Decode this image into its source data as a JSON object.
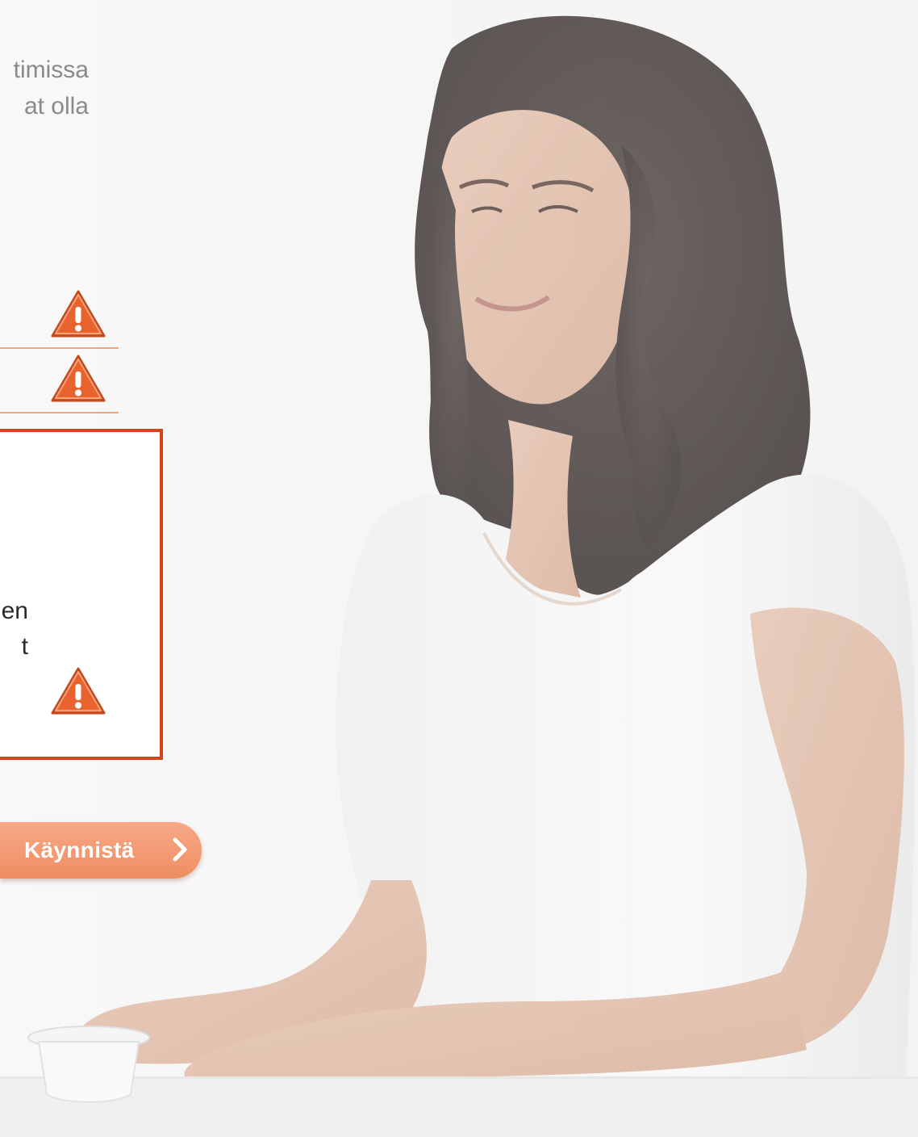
{
  "intro": {
    "line1": "timissa",
    "line2": "at olla"
  },
  "alert": {
    "line1": "en",
    "line2": "t"
  },
  "icons": {
    "warning": "warning-triangle-icon",
    "chevron": "chevron-right-icon"
  },
  "start_button": {
    "label": "Käynnistä"
  },
  "colors": {
    "accent": "#d5451b",
    "divider": "#f1a27a",
    "button": "#f08d62",
    "warning_fill": "#e8632d"
  }
}
